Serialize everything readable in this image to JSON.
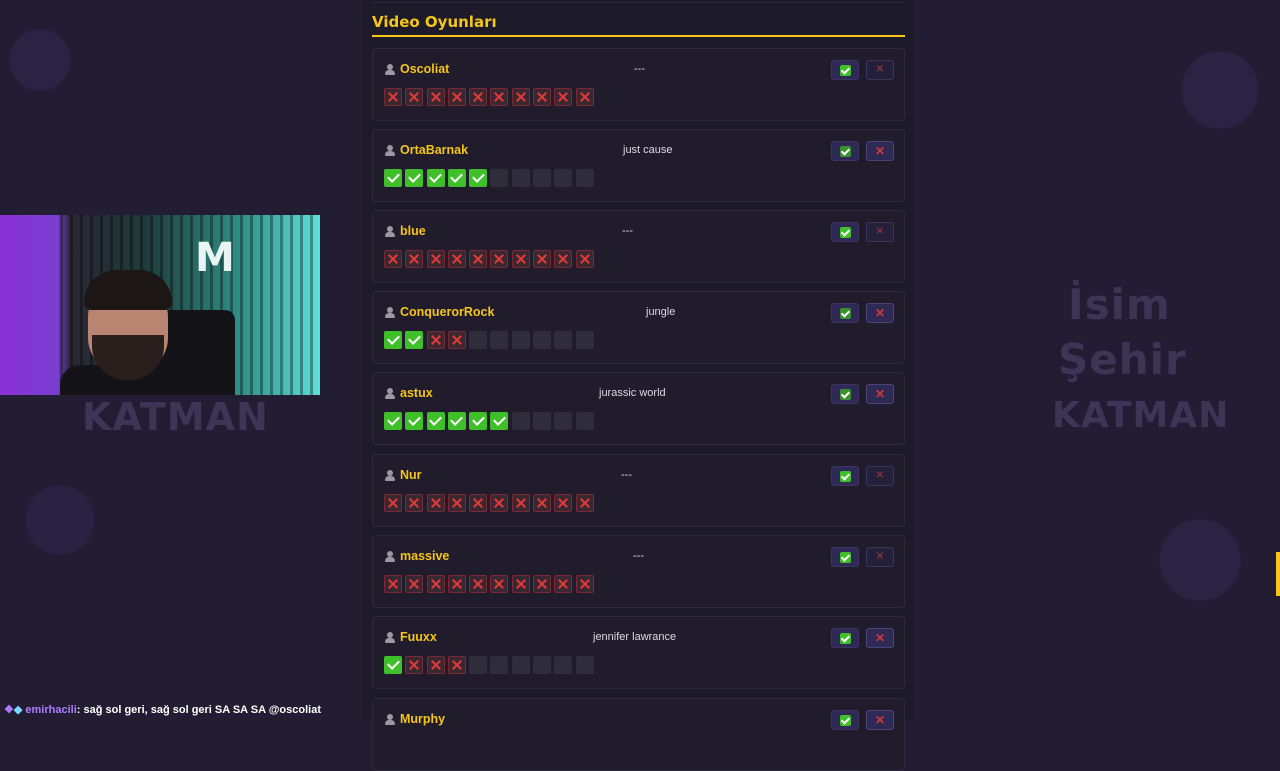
{
  "section": {
    "title": "Video Oyunları"
  },
  "players": [
    {
      "name": "Oscoliat",
      "answer": "---",
      "results": [
        "bad",
        "bad",
        "bad",
        "bad",
        "bad",
        "bad",
        "bad",
        "bad",
        "bad",
        "bad"
      ],
      "reject_active": false,
      "approve_dim": false
    },
    {
      "name": "OrtaBarnak",
      "answer": "just cause",
      "results": [
        "ok",
        "ok",
        "ok",
        "ok",
        "ok",
        "empty",
        "empty",
        "empty",
        "empty",
        "empty"
      ],
      "reject_active": true,
      "approve_dim": true
    },
    {
      "name": "blue",
      "answer": "---",
      "results": [
        "bad",
        "bad",
        "bad",
        "bad",
        "bad",
        "bad",
        "bad",
        "bad",
        "bad",
        "bad"
      ],
      "reject_active": false,
      "approve_dim": false
    },
    {
      "name": "ConquerorRock",
      "answer": "jungle",
      "results": [
        "ok",
        "ok",
        "bad",
        "bad",
        "empty",
        "empty",
        "empty",
        "empty",
        "empty",
        "empty"
      ],
      "reject_active": true,
      "approve_dim": true
    },
    {
      "name": "astux",
      "answer": "jurassic world",
      "results": [
        "ok",
        "ok",
        "ok",
        "ok",
        "ok",
        "ok",
        "empty",
        "empty",
        "empty",
        "empty"
      ],
      "reject_active": true,
      "approve_dim": true
    },
    {
      "name": "Nur",
      "answer": "---",
      "results": [
        "bad",
        "bad",
        "bad",
        "bad",
        "bad",
        "bad",
        "bad",
        "bad",
        "bad",
        "bad"
      ],
      "reject_active": false,
      "approve_dim": false
    },
    {
      "name": "massive",
      "answer": "---",
      "results": [
        "bad",
        "bad",
        "bad",
        "bad",
        "bad",
        "bad",
        "bad",
        "bad",
        "bad",
        "bad"
      ],
      "reject_active": false,
      "approve_dim": false
    },
    {
      "name": "Fuuxx",
      "answer": "jennifer lawrance",
      "results": [
        "ok",
        "bad",
        "bad",
        "bad",
        "empty",
        "empty",
        "empty",
        "empty",
        "empty",
        "empty"
      ],
      "reject_active": true,
      "approve_dim": false
    },
    {
      "name": "Murphy",
      "answer": "",
      "results": [],
      "reject_active": true,
      "approve_dim": false
    }
  ],
  "watermarks": {
    "left": "KATMAN",
    "right_1": "İsim",
    "right_2": "Şehir",
    "right_3": "KATMAN"
  },
  "webcam": {
    "logo": "M"
  },
  "chat": {
    "username": "emirhacili",
    "message": ": sağ sol geri, sağ sol geri SA SA SA @oscoliat"
  },
  "icons": {
    "approve": "check-icon",
    "reject": "x-icon",
    "user": "user-icon"
  },
  "colors": {
    "accent": "#f5c518",
    "ok": "#3fbf2a",
    "bad": "#e03a3a"
  }
}
